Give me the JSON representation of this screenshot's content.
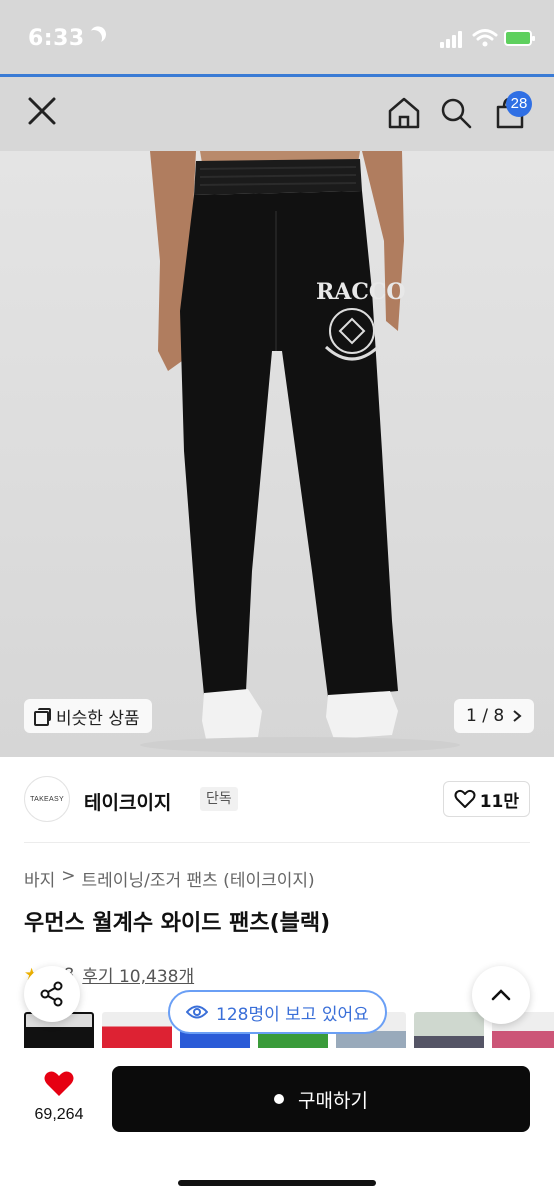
{
  "status_bar": {
    "time": "6:33"
  },
  "nav": {
    "cart_count": "28"
  },
  "image": {
    "similar_label": "비슷한 상품",
    "pager": "1 / 8"
  },
  "brand": {
    "logo_text": "TAKEASY",
    "name": "테이크이지",
    "tag": "단독",
    "likes": "11만"
  },
  "breadcrumb": {
    "category": "바지",
    "sub": "트레이닝/조거 팬츠 (테이크이지)"
  },
  "product": {
    "title": "우먼스 월계수 와이드 팬츠(블랙)"
  },
  "rating": {
    "score": "4.8",
    "reviews": "후기 10,438개"
  },
  "viewers": {
    "text": "128명이 보고 있어요"
  },
  "bottom": {
    "heart_count": "69,264",
    "buy_label": "구매하기"
  },
  "colors": {
    "accent": "#2f6fe4",
    "buy_bg": "#0b0b0b",
    "heart": "#e60012"
  },
  "icons": [
    "close-icon",
    "home-icon",
    "search-icon",
    "cart-icon",
    "share-icon",
    "chevron-up-icon",
    "eye-icon",
    "heart-icon"
  ]
}
